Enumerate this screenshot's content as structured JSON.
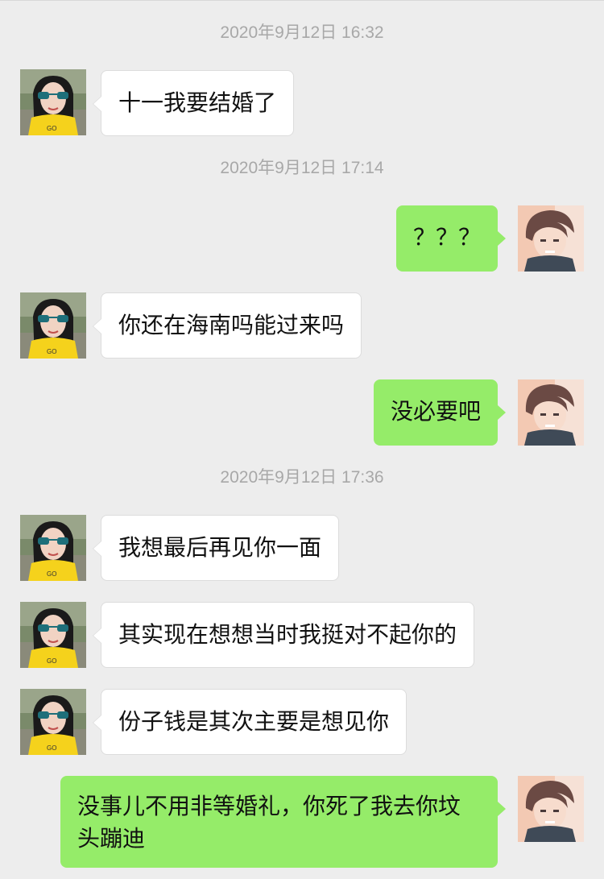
{
  "chat": {
    "timestamps": [
      "2020年9月12日 16:32",
      "2020年9月12日 17:14",
      "2020年9月12日 17:36"
    ],
    "messages": [
      {
        "side": "left",
        "text": "十一我要结婚了"
      },
      {
        "side": "right",
        "text": "？？？"
      },
      {
        "side": "left",
        "text": "你还在海南吗能过来吗"
      },
      {
        "side": "right",
        "text": "没必要吧"
      },
      {
        "side": "left",
        "text": "我想最后再见你一面"
      },
      {
        "side": "left",
        "text": "其实现在想想当时我挺对不起你的"
      },
      {
        "side": "left",
        "text": "份子钱是其次主要是想见你"
      },
      {
        "side": "right",
        "text": "没事儿不用非等婚礼，你死了我去你坟头蹦迪"
      }
    ]
  },
  "colors": {
    "background": "#ededed",
    "timestamp_text": "#a8a8a8",
    "bubble_left": "#ffffff",
    "bubble_right": "#95ec69",
    "text": "#111111"
  },
  "icons": {
    "left_avatar": "woman-sunglasses-avatar",
    "right_avatar": "anime-boy-avatar"
  }
}
